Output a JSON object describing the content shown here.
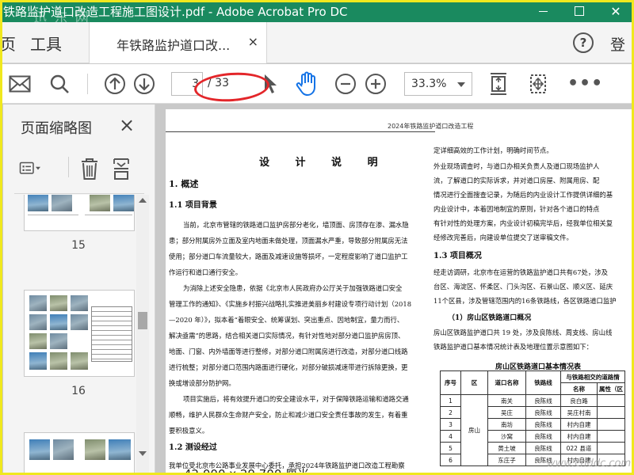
{
  "window": {
    "title": "铁路监护道口改造工程施工图设计.pdf - Adobe Acrobat Pro DC",
    "watermark_top": "迅 东 网"
  },
  "tabs": {
    "partial_left": "页",
    "tools": "工具",
    "doc_tab": "年铁路监护道口改...",
    "close": "×",
    "help": "?",
    "login": "登"
  },
  "toolbar": {
    "icons": [
      "mail-icon",
      "search-icon",
      "prev-page-icon",
      "next-page-icon",
      "pointer-icon",
      "hand-icon",
      "zoom-out-icon",
      "zoom-in-icon",
      "fit-page-icon",
      "fit-window-icon",
      "more-icon"
    ],
    "current_page": "3",
    "total_pages": "/ 33",
    "zoom": "33.3%",
    "more": "•••"
  },
  "panel": {
    "title": "页面缩略图",
    "close": "×",
    "thumbnails": [
      {
        "number": "15"
      },
      {
        "number": "16"
      }
    ]
  },
  "document": {
    "header": "2024年铁路监护道口改造工程",
    "title": "设 计 说 明",
    "left": {
      "h1": "1.  概述",
      "h11": "1.1  项目背景",
      "p1": [
        "当前，北京市管辖的铁路道口监护房部分老化，墙顶面、房顶存在渗、漏水隐",
        "患；部分附属房外立面及室内地面未做处理，顶面漏水严重，导致部分附属房无法",
        "使用；部分道口车流量较大，路面及减速设施等损坏，一定程度影响了道口监护工",
        "作运行和道口通行安全。"
      ],
      "p2": [
        "为消除上述安全隐患，依据《北京市人民政府办公厅关于加强铁路道口安全",
        "管理工作的通知》、《实施乡村振兴战略扎实推进美丽乡村建设专项行动计划（2018",
        "—2020 年）》，拟本着“着眼安全、统筹谋划、突出重点、因地制宜，量力而行、",
        "解决亟需”的思路，结合相关道口实际情况，有针对性地对部分道口监护房房顶、",
        "地面、门窗、内外墙面等进行整修，对部分道口附属房进行改造，对部分道口线路",
        "进行梳整；对部分道口范围内路面进行硬化，对部分破损减速带进行拆除更换，更",
        "换或增设部分防护网。"
      ],
      "p3": [
        "项目实施后，将有效提升道口的安全建设水平，对于保障铁路运输和道路交通",
        "顺畅，维护人民群众生命财产安全，防止和减少道口安全责任事故的发生，有着重",
        "要积极意义。"
      ],
      "h12": "1.2  测设经过",
      "p4": "    我单位受北京市公路事业发展中心委托，承担2024年铁路监护道口改造工程勘察"
    },
    "right": {
      "p1": [
        "定详细高效的工作计划，明确时间节点。",
        "    外业现场调查时，与道口办相关负责人及道口现场监护人",
        "流，了解道口的实际诉求，并对道口房屋、附属用房、配",
        "情况进行全面搜查记录，为随后的内业设计工作提供详细的基",
        "    内业设计中，本着因地制宜的原则，针对各个道口的特点",
        "有针对性的处理方案，内业设计初稿完毕后，经我单位相关复",
        "经修改完善后，向建设单位提交了送审稿文件。"
      ],
      "h13": "1.3  项目概况",
      "p2": [
        "    经走访调研，北京市在运营的铁路监护道口共有67处，涉及",
        "台区、海淀区、怀柔区、门头沟区、石景山区、顺义区、延庆",
        "11个区县，涉及管辖范围内的16条铁路线，各区铁路道口监护"
      ],
      "h131": "（1）房山区铁路道口概况",
      "p3": [
        "    房山区铁路监护道口共 19 处，涉及良陈线、周支线、房山线",
        "铁路监护道口基本情况统计表及地理位置示意图如下："
      ],
      "table_title": "房山区铁路道口基本情况表",
      "table_headers": [
        "序号",
        "区",
        "道口名称",
        "铁路线",
        "与铁路相交的道路情",
        "名称",
        "属性（区"
      ],
      "table_rows": [
        [
          "1",
          "南关",
          "良陈线",
          "良白路"
        ],
        [
          "2",
          "吴庄",
          "良陈线",
          "吴庄村南"
        ],
        [
          "3",
          "南坊",
          "良陈线",
          "村内自建"
        ],
        [
          "4",
          "沙窝",
          "良陈线",
          "村内自建"
        ],
        [
          "5",
          "黄土坡",
          "良陈线",
          "022 县道"
        ],
        [
          "6",
          "东庄子",
          "良陈线",
          "村内自建"
        ]
      ],
      "district": "房山"
    }
  },
  "footer": {
    "page_size": "42.000 x 29.700 厘米",
    "watermark": "www.cnddc.com"
  },
  "colors": {
    "titlebar": "#1a8a5f",
    "annotation_ellipse": "#e3262a",
    "frame": "#f0e81e",
    "hand_tool": "#1473e6"
  }
}
